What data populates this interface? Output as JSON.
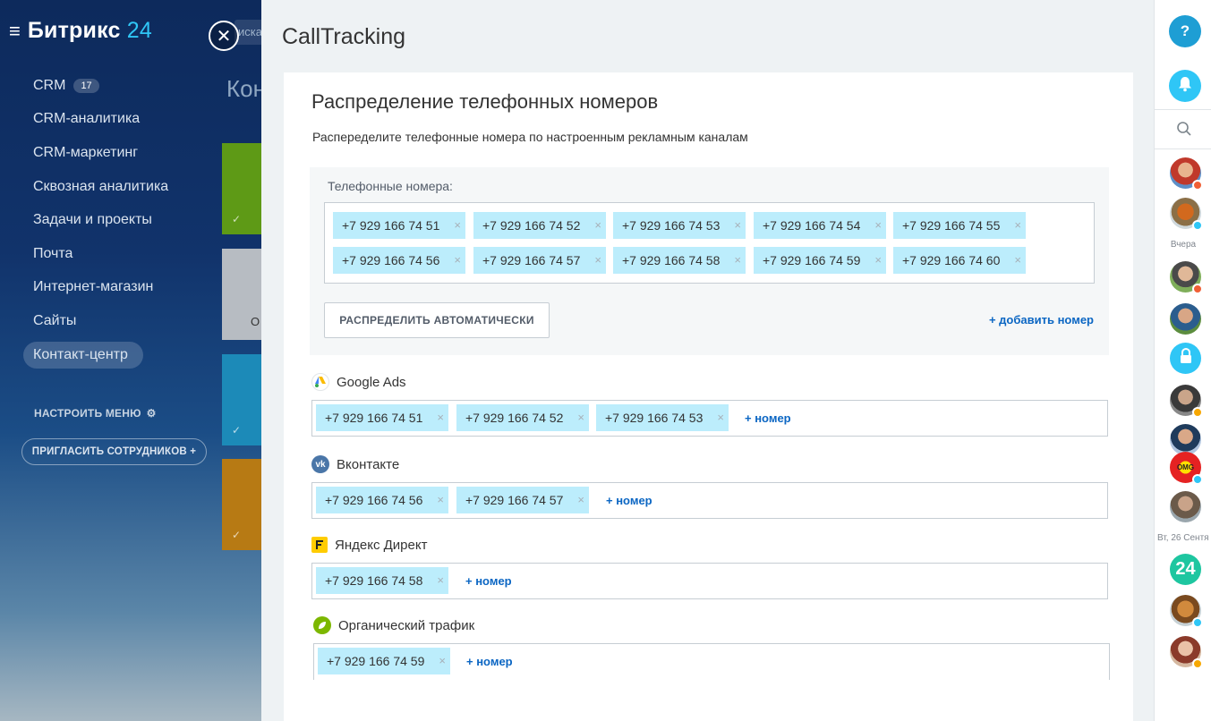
{
  "background_app": {
    "logo_text": "Битрикс",
    "logo_number": "24",
    "search_fragment": "иска",
    "page_title_fragment": "Кон",
    "tile_label_fragment": "О",
    "menu": [
      {
        "label": "CRM",
        "badge": "17"
      },
      {
        "label": "CRM-аналитика"
      },
      {
        "label": "CRM-маркетинг"
      },
      {
        "label": "Сквозная аналитика"
      },
      {
        "label": "Задачи и проекты"
      },
      {
        "label": "Почта"
      },
      {
        "label": "Интернет-магазин"
      },
      {
        "label": "Сайты"
      },
      {
        "label": "Контакт-центр",
        "active": true
      }
    ],
    "configure_menu": "НАСТРОИТЬ МЕНЮ",
    "invite": "ПРИГЛАСИТЬ СОТРУДНИКОВ +"
  },
  "slider": {
    "title": "CallTracking",
    "section_title": "Распределение телефонных номеров",
    "description": "Распеределите телефонные номера по настроенным рекламным каналам",
    "pool_label": "Телефонные номера:",
    "pool_numbers": [
      "+7 929 166 74 51",
      "+7 929 166 74 52",
      "+7 929 166 74 53",
      "+7 929 166 74 54",
      "+7 929 166 74 55",
      "+7 929 166 74 56",
      "+7 929 166 74 57",
      "+7 929 166 74 58",
      "+7 929 166 74 59",
      "+7 929 166 74 60"
    ],
    "auto_button": "РАСПРЕДЕЛИТЬ АВТОМАТИЧЕСКИ",
    "add_number": "+ добавить номер",
    "channels": [
      {
        "name": "Google Ads",
        "numbers": [
          "+7 929 166 74 51",
          "+7 929 166 74 52",
          "+7 929 166 74 53"
        ],
        "add": "+ номер"
      },
      {
        "name": "Вконтакте",
        "numbers": [
          "+7 929 166 74 56",
          "+7 929 166 74 57"
        ],
        "add": "+ номер"
      },
      {
        "name": "Яндекс Директ",
        "numbers": [
          "+7 929 166 74 58"
        ],
        "add": "+ номер"
      },
      {
        "name": "Органический трафик",
        "numbers": [
          "+7 929 166 74 59"
        ],
        "add": "+ номер"
      }
    ],
    "remove_glyph": "×"
  },
  "rightbar": {
    "help_glyph": "?",
    "label_yesterday": "Вчера",
    "label_date": "Вт, 26 Сентя",
    "b24_text": "24",
    "omg_text": "OMG"
  },
  "colors": {
    "accent": "#2fc6f6",
    "tag_bg": "#bcedfc",
    "link": "#0b66c3",
    "b24_green": "#1ec6a0"
  }
}
